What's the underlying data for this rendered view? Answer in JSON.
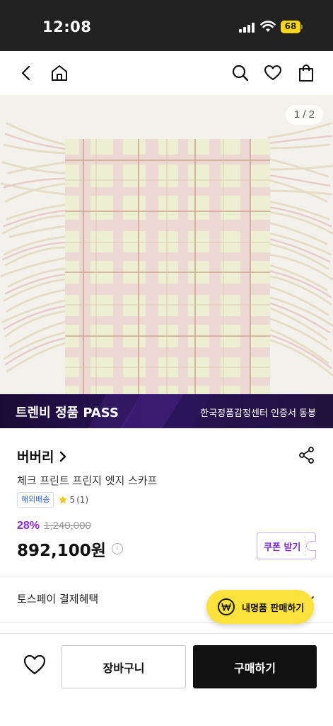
{
  "status_bar": {
    "time": "12:08",
    "battery": "68"
  },
  "nav": {
    "back_icon": "chevron-left-icon",
    "home_icon": "home-icon",
    "search_icon": "search-icon",
    "wishlist_icon": "heart-icon",
    "cart_icon": "shopping-bag-icon"
  },
  "image": {
    "counter": "1 / 2"
  },
  "pass_banner": {
    "title": "트렌비 정품 PASS",
    "subtitle": "한국정품감정센터 인증서 동봉"
  },
  "product": {
    "brand": "버버리",
    "name": "체크 프린트 프린지 엣지 스카프",
    "shipping_tag": "해외배송",
    "rating": "5",
    "review_count": "(1)",
    "discount": "28%",
    "original_price": "1,240,000",
    "price": "892,100원",
    "coupon_label": "쿠폰 받기"
  },
  "benefits": {
    "label": "토스페이 결제혜택"
  },
  "sell_button": {
    "label": "내명품 판매하기"
  },
  "bottom_bar": {
    "cart_label": "장바구니",
    "buy_label": "구매하기"
  },
  "colors": {
    "accent_purple": "#7c2bd0",
    "sell_yellow": "#fde23b",
    "buy_black": "#111111"
  }
}
